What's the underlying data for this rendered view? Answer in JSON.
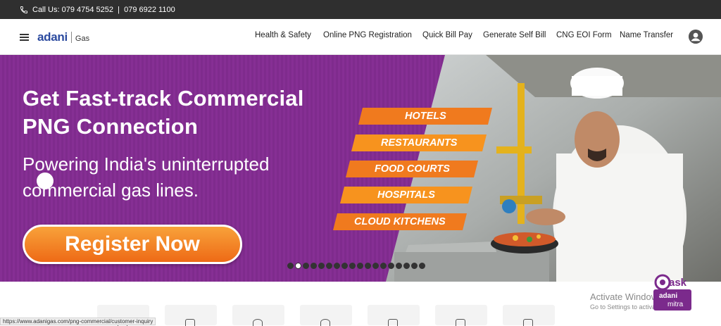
{
  "topbar": {
    "call_label": "Call Us:",
    "phone_1": "079 4754 5252",
    "divider": "|",
    "phone_2": "079 6922 1100"
  },
  "header": {
    "logo_brand": "adani",
    "logo_sub": "Gas",
    "nav": [
      {
        "label": "Health & Safety"
      },
      {
        "label": "Online PNG Registration"
      },
      {
        "label": "Quick Bill Pay"
      },
      {
        "label": "Generate Self Bill"
      },
      {
        "label": "CNG EOI Form"
      },
      {
        "label": "Name Transfer"
      }
    ]
  },
  "banner": {
    "headline_1": "Get Fast-track Commercial",
    "headline_2": "PNG Connection",
    "subline_1": "Powering India's uninterrupted",
    "subline_2": "commercial gas lines.",
    "cta": "Register Now",
    "tags": [
      "HOTELS",
      "RESTAURANTS",
      "FOOD COURTS",
      "HOSPITALS",
      "CLOUD KITCHENS"
    ],
    "slide_count": 18,
    "active_slide": 2
  },
  "status_url": "https://www.adanigas.com/png-commercial/customer-inquiry",
  "windows_notice": {
    "line_1": "Activate Windows",
    "line_2": "Go to Settings to activate Windows."
  },
  "assistant": {
    "label_1": "ask",
    "label_2": "adani",
    "label_3": "mitra"
  },
  "colors": {
    "topbar": "#2f2f2f",
    "brand_blue": "#2b4a9f",
    "banner_purple": "#862f94",
    "cta_orange": "#ee6a16",
    "tag_orange": "#f7931e"
  },
  "icons": [
    "phone-icon",
    "hamburger-icon",
    "user-account-icon"
  ]
}
